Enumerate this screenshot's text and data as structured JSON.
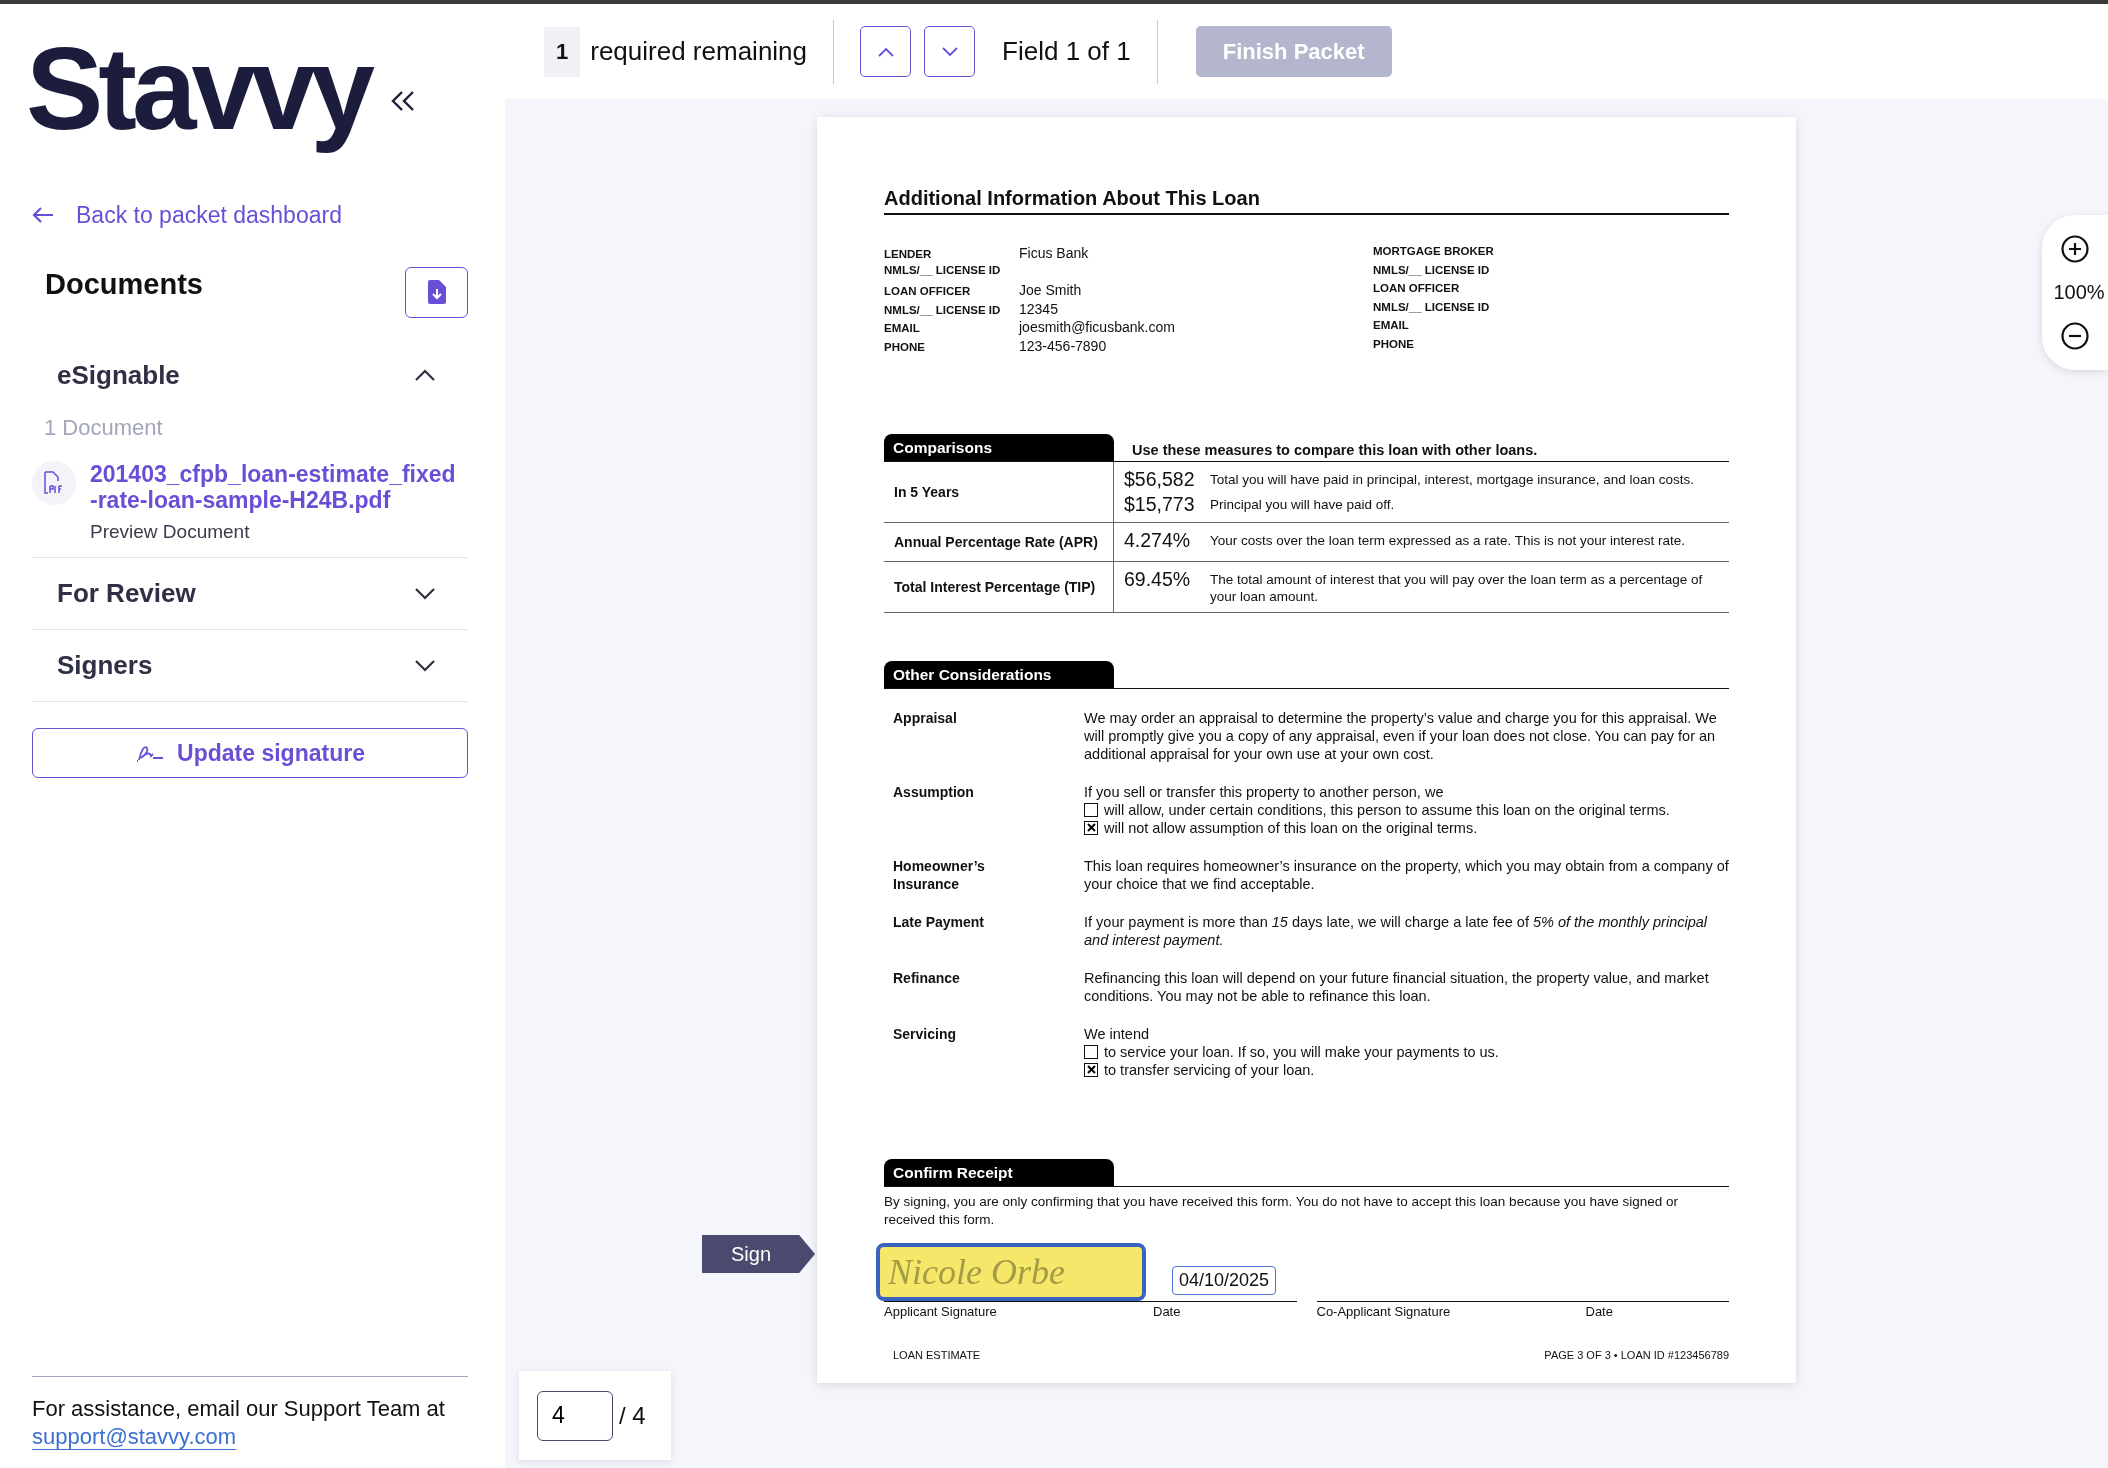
{
  "logo": "Stavvy",
  "sidebar": {
    "back_link": "Back to packet dashboard",
    "heading": "Documents",
    "sections": [
      {
        "title": "eSignable",
        "expanded": true,
        "count": "1 Document",
        "documents": [
          {
            "name": "201403_cfpb_loan-estimate_fixed-rate-loan-sample-H24B.pdf",
            "action": "Preview Document"
          }
        ]
      },
      {
        "title": "For Review",
        "expanded": false
      },
      {
        "title": "Signers",
        "expanded": false
      }
    ],
    "update_button": "Update signature",
    "footer": {
      "text": "For assistance, email our Support Team at",
      "email": "support@stavvy.com"
    }
  },
  "toolbar": {
    "required_count": "1",
    "required_label": "required remaining",
    "field_position": "Field 1 of 1",
    "finish_button": {
      "label": "Finish Packet",
      "disabled": true
    }
  },
  "zoom": {
    "level_text": "100%"
  },
  "sign_tag": "Sign",
  "pager": {
    "page": "4",
    "total": "/ 4"
  },
  "document": {
    "title": "Additional Information About This Loan",
    "parties": [
      {
        "rows": [
          {
            "label": "LENDER",
            "value": "Ficus Bank"
          },
          {
            "label": "NMLS/__ LICENSE ID"
          },
          {
            "label": "LOAN OFFICER",
            "value": "Joe Smith"
          },
          {
            "label": "NMLS/__ LICENSE ID",
            "value": "12345"
          },
          {
            "label": "EMAIL",
            "value": "joesmith@ficusbank.com"
          },
          {
            "label": "PHONE",
            "value": "123-456-7890"
          }
        ]
      },
      {
        "rows": [
          {
            "label": "MORTGAGE BROKER"
          },
          {
            "label": "NMLS/__ LICENSE ID"
          },
          {
            "label": "LOAN OFFICER"
          },
          {
            "label": "NMLS/__ LICENSE ID"
          },
          {
            "label": "EMAIL"
          },
          {
            "label": "PHONE"
          }
        ]
      }
    ],
    "comparisons": {
      "heading": "Comparisons",
      "note": "Use these measures to compare this loan with other loans.",
      "rows": [
        {
          "label": "In 5 Years",
          "items": [
            {
              "value": "$56,582",
              "text": "Total you will have paid in principal, interest, mortgage insurance, and loan costs."
            },
            {
              "value": "$15,773",
              "text": "Principal you will have paid off."
            }
          ]
        },
        {
          "label": "Annual Percentage Rate (APR)",
          "items": [
            {
              "value": "4.274%",
              "text": "Your costs over the loan term expressed as a rate. This is not your interest rate."
            }
          ]
        },
        {
          "label": "Total Interest Percentage (TIP)",
          "items": [
            {
              "value": "69.45%",
              "text": "The total amount of interest that you will pay over the loan term as a percentage of your loan amount."
            }
          ]
        }
      ]
    },
    "considerations": {
      "heading": "Other Considerations",
      "rows": [
        {
          "label": "Appraisal",
          "text": "We may order an appraisal to determine the property’s value and charge you for this appraisal. We will promptly give you a copy of any appraisal, even if your loan does not close. You can pay for an additional appraisal for your own use at your own cost."
        },
        {
          "label": "Assumption",
          "text": "If you sell or transfer this property to another person, we",
          "options": [
            {
              "text": "will allow, under certain conditions,  this person to assume this loan on the original terms.",
              "checked": false
            },
            {
              "text": "will not allow assumption of this loan on the original terms.",
              "checked": true
            }
          ]
        },
        {
          "label": "Homeowner’s Insurance",
          "text": "This loan requires homeowner’s insurance on the property, which you may obtain from a company of your choice that we find acceptable."
        },
        {
          "label": "Late Payment",
          "text": "If your payment is more than *15* days late, we will charge a late fee of *5% of the monthly principal and interest payment.*"
        },
        {
          "label": "Refinance",
          "text": "Refinancing this loan will depend on your future financial situation, the property value, and market conditions. You may not be able to refinance this loan."
        },
        {
          "label": "Servicing",
          "text": "We intend",
          "options": [
            {
              "text": "to service your loan. If so, you will make your payments to us.",
              "checked": false
            },
            {
              "text": "to transfer servicing of your loan.",
              "checked": true
            }
          ]
        }
      ]
    },
    "confirm": {
      "heading": "Confirm Receipt",
      "text": "By signing, you are only confirming that you have received this form. You do not have to accept this loan because you have signed or received this form.",
      "signature": {
        "value": "Nicole Orbe",
        "selected": true
      },
      "date": "04/10/2025",
      "labels": [
        "Applicant Signature",
        "Date",
        "Co-Applicant Signature",
        "Date"
      ]
    },
    "footer": {
      "left": "LOAN ESTIMATE",
      "right": "PAGE 3 OF 3 • LOAN ID #123456789"
    }
  }
}
